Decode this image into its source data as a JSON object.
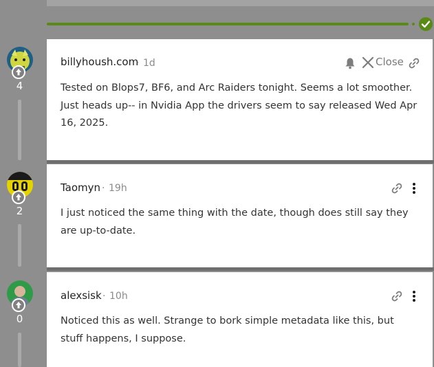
{
  "colors": {
    "accent_green": "#5a8a16",
    "page_background": "#8e8e8e",
    "card_background": "#ffffff",
    "meta_text": "#8a8a8a"
  },
  "posts": [
    {
      "author": "billyhoush.com",
      "separator": "·",
      "time": "1d",
      "votes": "4",
      "body": "Tested on Blops7, BF6, and Arc Raiders tonight. Seems a lot smoother. Just heads up-- in Nvidia App the drivers seem to say released Wed Apr 16, 2025.",
      "actions": [
        "bell-icon",
        "close-icon",
        "link-icon"
      ],
      "close_label": "Close"
    },
    {
      "author": "Taomyn",
      "separator": "·",
      "time": "19h",
      "votes": "2",
      "body": "I just noticed the same thing with the date, though does still say they are up-to-date.",
      "actions": [
        "link-icon",
        "more-icon"
      ]
    },
    {
      "author": "alexsisk",
      "separator": "·",
      "time": "10h",
      "votes": "0",
      "body": "Noticed this as well. Strange to bork simple metadata like this, but stuff happens, I suppose.",
      "actions": [
        "link-icon",
        "more-icon"
      ]
    }
  ]
}
